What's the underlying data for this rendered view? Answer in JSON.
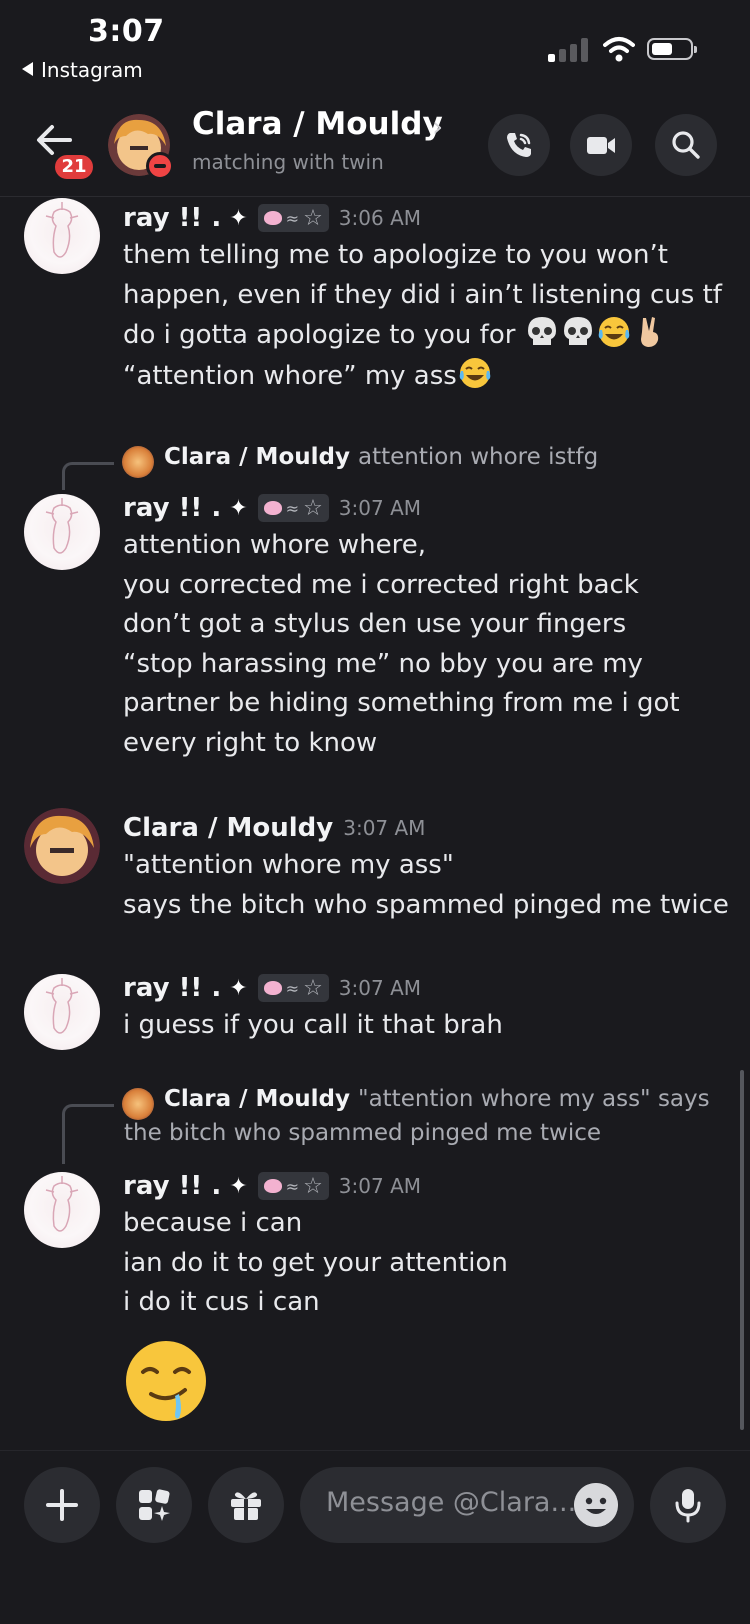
{
  "status_bar": {
    "time": "3:07",
    "back_app": "Instagram"
  },
  "header": {
    "title": "Clara / Mouldy",
    "subtitle": "matching with twin",
    "unread_badge": "21"
  },
  "messages": [
    {
      "author": "ray !! .",
      "time": "3:06 AM",
      "lines": [
        "them telling me to apologize to you won’t",
        "happen, even if they did i ain’t listening cus tf",
        "do i gotta apologize to you for",
        "“attention whore” my ass"
      ]
    },
    {
      "reply_to": {
        "author": "Clara / Mouldy",
        "text": "attention whore istfg"
      },
      "author": "ray !! .",
      "time": "3:07 AM",
      "lines": [
        "attention whore where,",
        "you corrected me i corrected right back",
        "don’t got a stylus den use your fingers",
        "“stop harassing me” no bby you are my",
        "partner be hiding something from me i got",
        "every right to know"
      ]
    },
    {
      "author": "Clara / Mouldy",
      "time": "3:07 AM",
      "lines": [
        "\"attention whore my ass\"",
        "says the bitch who spammed pinged me twice"
      ]
    },
    {
      "author": "ray !! .",
      "time": "3:07 AM",
      "lines": [
        "i guess if you call it that brah"
      ]
    },
    {
      "reply_to": {
        "author": "Clara / Mouldy",
        "text_line1": "\"attention whore my ass\" says",
        "text_line2": "the bitch who spammed pinged me twice"
      },
      "author": "ray !! .",
      "time": "3:07 AM",
      "lines": [
        "because i can",
        "ian do it to get your attention",
        "i do it cus i can"
      ]
    }
  ],
  "composer": {
    "placeholder": "Message @Clara..."
  },
  "icons": {
    "author_sparkle": "sparkle-icon",
    "role_tag": [
      "pink-heart-icon",
      "lines-icon",
      "star-icon"
    ],
    "emojis": [
      "skull-emoji",
      "skull-emoji",
      "tears-of-joy-emoji",
      "victory-hand-emoji",
      "tears-of-joy-emoji",
      "drooling-face-emoji"
    ]
  },
  "colors": {
    "background": "#1a1a1e",
    "badge": "#e03c3c",
    "dnd": "#ef4444"
  }
}
